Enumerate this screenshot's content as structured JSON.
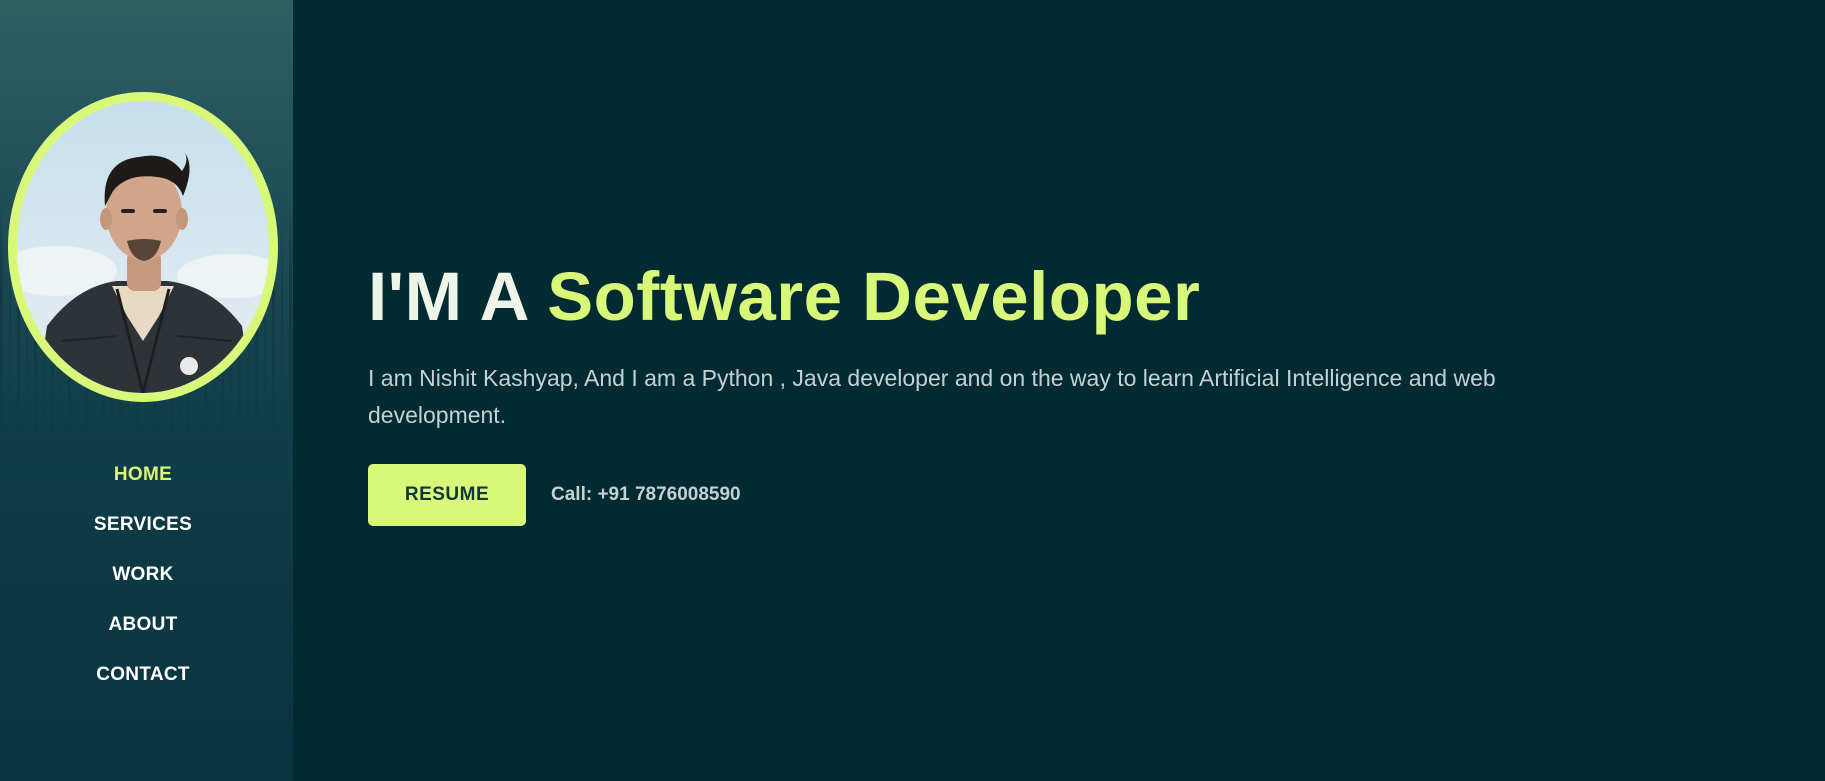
{
  "sidebar": {
    "nav": [
      {
        "label": "HOME",
        "active": true
      },
      {
        "label": "SERVICES",
        "active": false
      },
      {
        "label": "WORK",
        "active": false
      },
      {
        "label": "ABOUT",
        "active": false
      },
      {
        "label": "CONTACT",
        "active": false
      }
    ]
  },
  "hero": {
    "title_prefix": "I'M A",
    "title_accent": "Software Developer",
    "description": "I am Nishit Kashyap, And I am a Python , Java developer and on the way to learn Artificial Intelligence and web development.",
    "resume_label": "RESUME",
    "call_text": "Call: +91 7876008590"
  },
  "colors": {
    "background": "#022a33",
    "accent": "#d9f779",
    "sidebar": "#0f3d48",
    "text": "#c4d1d3"
  }
}
